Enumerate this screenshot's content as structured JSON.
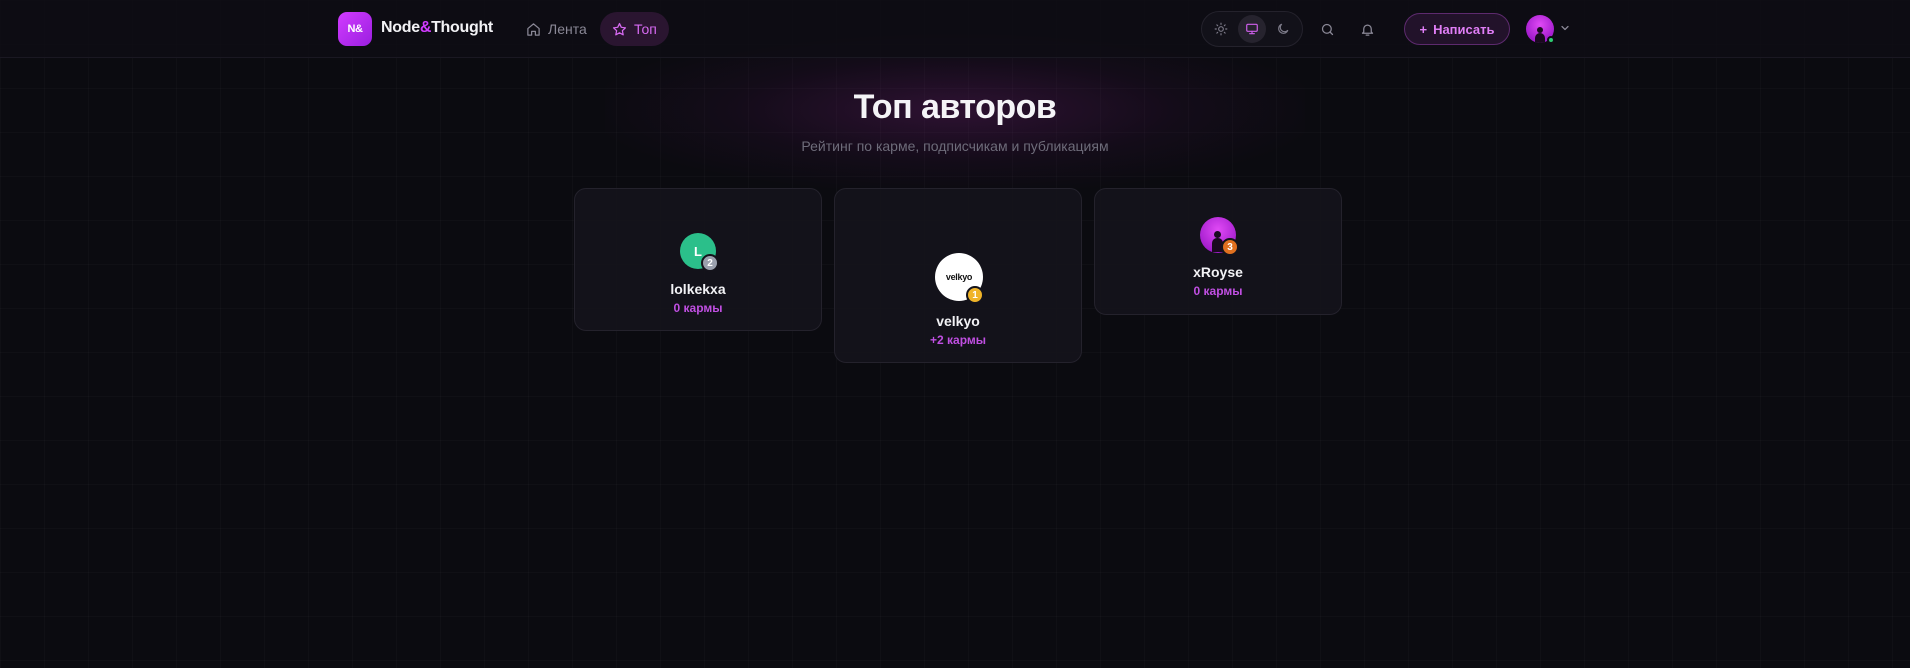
{
  "header": {
    "logo_mark": "N&",
    "brand_part1": "Node",
    "brand_amp": "&",
    "brand_part2": "Thought",
    "nav": [
      {
        "label": "Лента",
        "icon": "home-icon"
      },
      {
        "label": "Топ",
        "icon": "star-icon",
        "active": true
      }
    ],
    "theme_options": [
      {
        "name": "light",
        "icon": "sun-icon"
      },
      {
        "name": "system",
        "icon": "monitor-icon",
        "active": true
      },
      {
        "name": "dark",
        "icon": "moon-icon"
      }
    ],
    "write_label": "Написать",
    "user_status": "online"
  },
  "page": {
    "title": "Топ авторов",
    "subtitle": "Рейтинг по карме, подписчикам и публикациям"
  },
  "authors": [
    {
      "rank": "1",
      "name": "velkyo",
      "karma": "+2 кармы",
      "avatar_text": "velkyo"
    },
    {
      "rank": "2",
      "name": "lolkekxa",
      "karma": "0 кармы",
      "avatar_text": "L"
    },
    {
      "rank": "3",
      "name": "xRoyse",
      "karma": "0 кармы",
      "avatar_text": ""
    }
  ],
  "colors": {
    "accent": "#d13bff",
    "background": "#0b0b10",
    "karma": "#c04fe2",
    "rank_gold": "#f0b429",
    "rank_silver": "#9aa0ad",
    "rank_bronze": "#e0701f",
    "online": "#2ecc71"
  }
}
